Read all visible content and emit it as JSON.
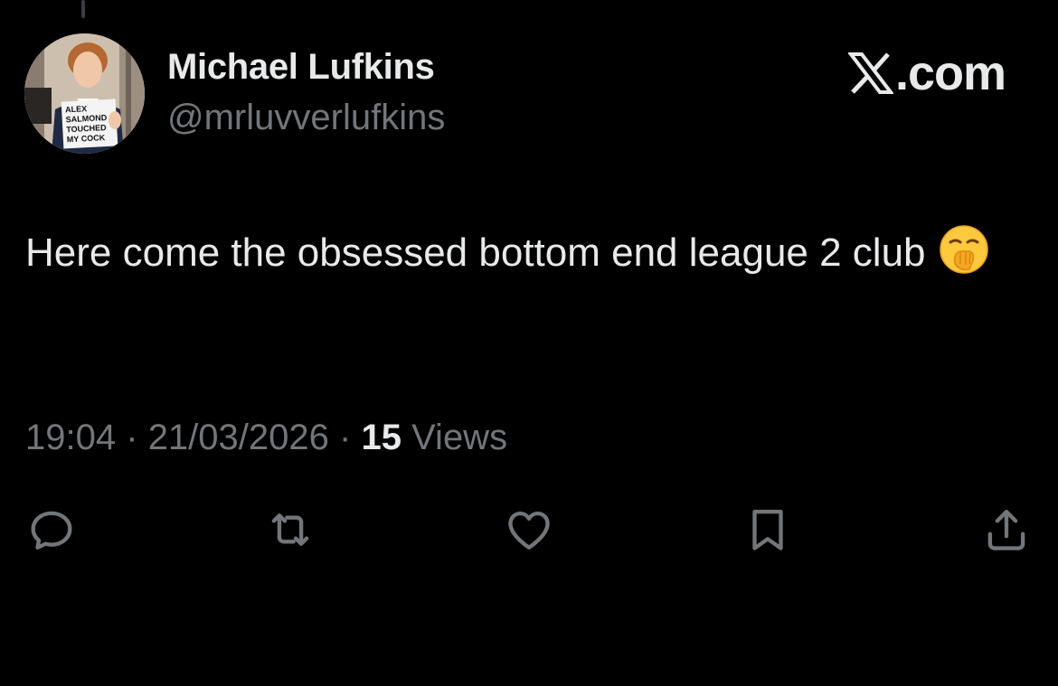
{
  "author": {
    "display_name": "Michael Lufkins",
    "handle": "@mrluvverlufkins",
    "avatar_sign_lines": [
      "ALEX",
      "SALMOND",
      "TOUCHED",
      "MY COCK"
    ]
  },
  "brand": {
    "label": ".com",
    "icon": "x-logo-icon"
  },
  "tweet": {
    "text": "Here come the obsessed bottom end league 2 club",
    "emoji": "yawning-face-icon"
  },
  "meta": {
    "time": "19:04",
    "separator": "·",
    "date": "21/03/2026",
    "views_count": "15",
    "views_label": "Views"
  },
  "actions": [
    {
      "name": "reply",
      "icon": "reply-icon"
    },
    {
      "name": "repost",
      "icon": "repost-icon"
    },
    {
      "name": "like",
      "icon": "heart-icon"
    },
    {
      "name": "bookmark",
      "icon": "bookmark-icon"
    },
    {
      "name": "share",
      "icon": "share-icon"
    }
  ],
  "colors": {
    "background": "#000000",
    "primary_text": "#e7e9ea",
    "secondary_text": "#71767b"
  }
}
